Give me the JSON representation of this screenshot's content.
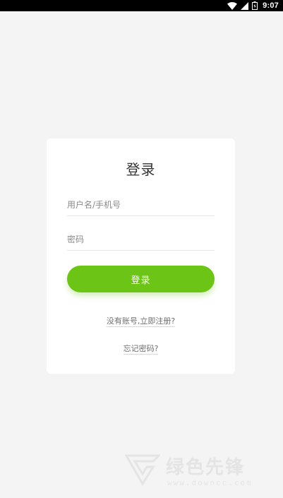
{
  "status_bar": {
    "time": "9:07",
    "icons": [
      "wifi-icon",
      "signal-icon",
      "battery-icon"
    ]
  },
  "login": {
    "title": "登录",
    "username": {
      "placeholder": "用户名/手机号",
      "value": ""
    },
    "password": {
      "placeholder": "密码",
      "value": ""
    },
    "button_label": "登录",
    "register_link": "没有账号,立即注册?",
    "forgot_link": "忘记密码?"
  },
  "watermark": {
    "text": "绿色先锋",
    "url": "www.downcc.com"
  },
  "colors": {
    "accent": "#6cc417",
    "background": "#f4f4f4",
    "card": "#ffffff",
    "status_bar": "#000000"
  }
}
